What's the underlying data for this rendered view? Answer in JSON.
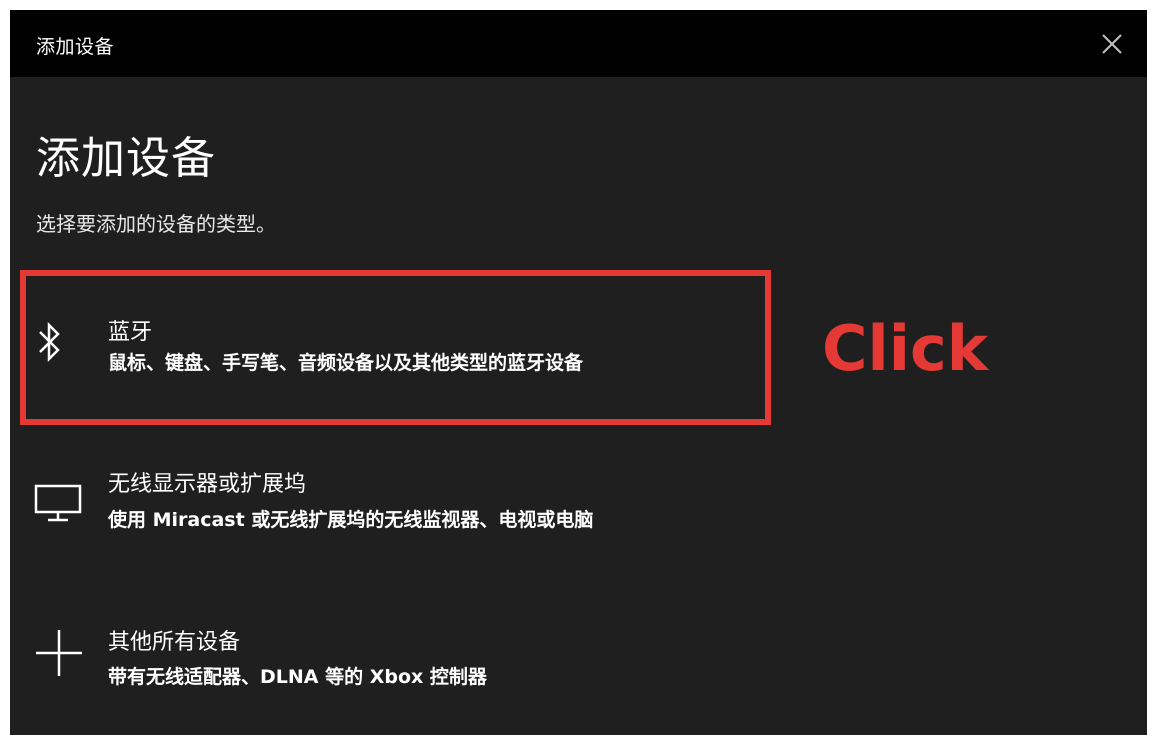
{
  "window": {
    "title": "添加设备",
    "close_icon": "close-icon"
  },
  "page": {
    "heading": "添加设备",
    "subtitle": "选择要添加的设备的类型。"
  },
  "options": [
    {
      "icon": "bluetooth-icon",
      "title": "蓝牙",
      "description": "鼠标、键盘、手写笔、音频设备以及其他类型的蓝牙设备"
    },
    {
      "icon": "monitor-icon",
      "title": "无线显示器或扩展坞",
      "description": "使用 Miracast 或无线扩展坞的无线监视器、电视或电脑"
    },
    {
      "icon": "plus-icon",
      "title": "其他所有设备",
      "description": "带有无线适配器、DLNA 等的 Xbox 控制器"
    }
  ],
  "annotation": {
    "label": "Click",
    "color": "#e53935"
  },
  "colors": {
    "titlebar_bg": "#000000",
    "window_bg": "#1f1f1f",
    "text": "#ffffff",
    "accent_annotation": "#e53935"
  }
}
